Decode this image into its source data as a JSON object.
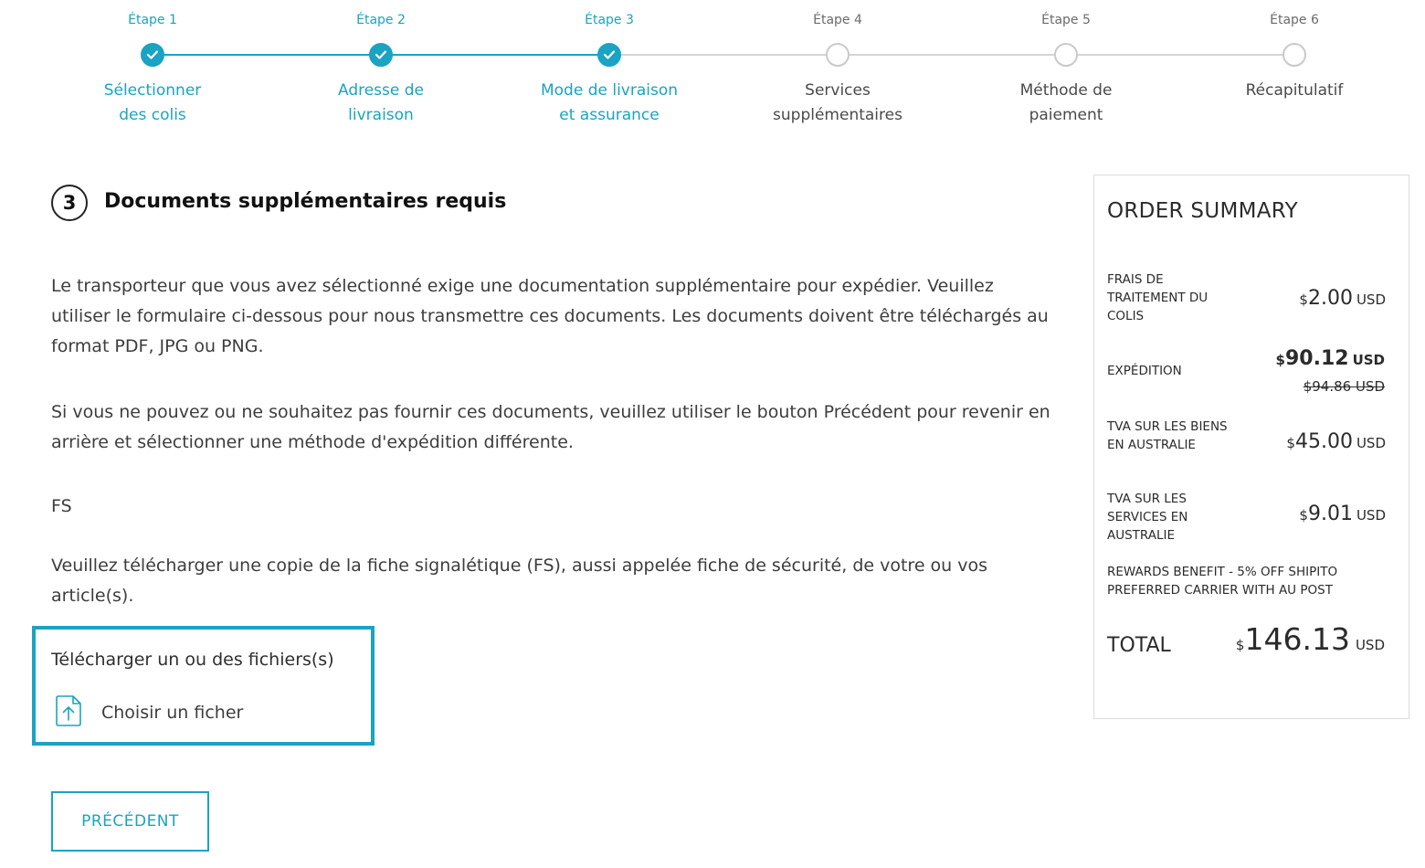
{
  "colors": {
    "accent": "#1aa3c2",
    "pending": "#c9c9c9",
    "text": "#3d3d3d"
  },
  "stepper": {
    "steps": [
      {
        "number": "Étape 1",
        "label_line1": "Sélectionner",
        "label_line2": "des colis",
        "status": "done"
      },
      {
        "number": "Étape 2",
        "label_line1": "Adresse de",
        "label_line2": "livraison",
        "status": "done"
      },
      {
        "number": "Étape 3",
        "label_line1": "Mode de livraison",
        "label_line2": "et assurance",
        "status": "done"
      },
      {
        "number": "Étape 4",
        "label_line1": "Services",
        "label_line2": "supplémentaires",
        "status": "pending"
      },
      {
        "number": "Étape 5",
        "label_line1": "Méthode de",
        "label_line2": "paiement",
        "status": "pending"
      },
      {
        "number": "Étape 6",
        "label_line1": "Récapitulatif",
        "label_line2": "",
        "status": "pending"
      }
    ]
  },
  "section": {
    "number": "3",
    "title": "Documents supplémentaires requis",
    "para1": "Le transporteur que vous avez sélectionné exige une documentation supplémentaire pour expédier. Veuillez utiliser le formulaire ci-dessous pour nous transmettre ces documents. Les documents doivent être téléchargés au format PDF, JPG ou PNG.",
    "para2": "Si vous ne pouvez ou ne souhaitez pas fournir ces documents, veuillez utiliser le bouton Précédent pour revenir en arrière et sélectionner une méthode d'expédition différente.",
    "doc_code": "FS",
    "doc_desc": "Veuillez télécharger une copie de la fiche signalétique (FS), aussi appelée fiche de sécurité, de votre ou vos article(s)."
  },
  "upload": {
    "title": "Télécharger un ou des fichiers(s)",
    "choose_label": "Choisir un ficher",
    "icon": "upload-file-icon"
  },
  "buttons": {
    "previous": "PRÉCÉDENT"
  },
  "summary": {
    "title": "ORDER SUMMARY",
    "rows": [
      {
        "label": "Frais de traitement du colis",
        "currency": "$",
        "amount": "2.00",
        "unit": "USD"
      },
      {
        "label": "Expédition",
        "currency": "$",
        "amount": "90.12",
        "unit": "USD",
        "original": "$94.86 USD"
      },
      {
        "label": "TVA sur les biens en Australie",
        "currency": "$",
        "amount": "45.00",
        "unit": "USD"
      },
      {
        "label": "TVA sur les services en Australie",
        "currency": "$",
        "amount": "9.01",
        "unit": "USD"
      }
    ],
    "reward": "Rewards Benefit - 5% off Shipito Preferred Carrier with AU Post",
    "total_label": "TOTAL",
    "total_currency": "$",
    "total_amount": "146.13",
    "total_unit": "USD"
  }
}
